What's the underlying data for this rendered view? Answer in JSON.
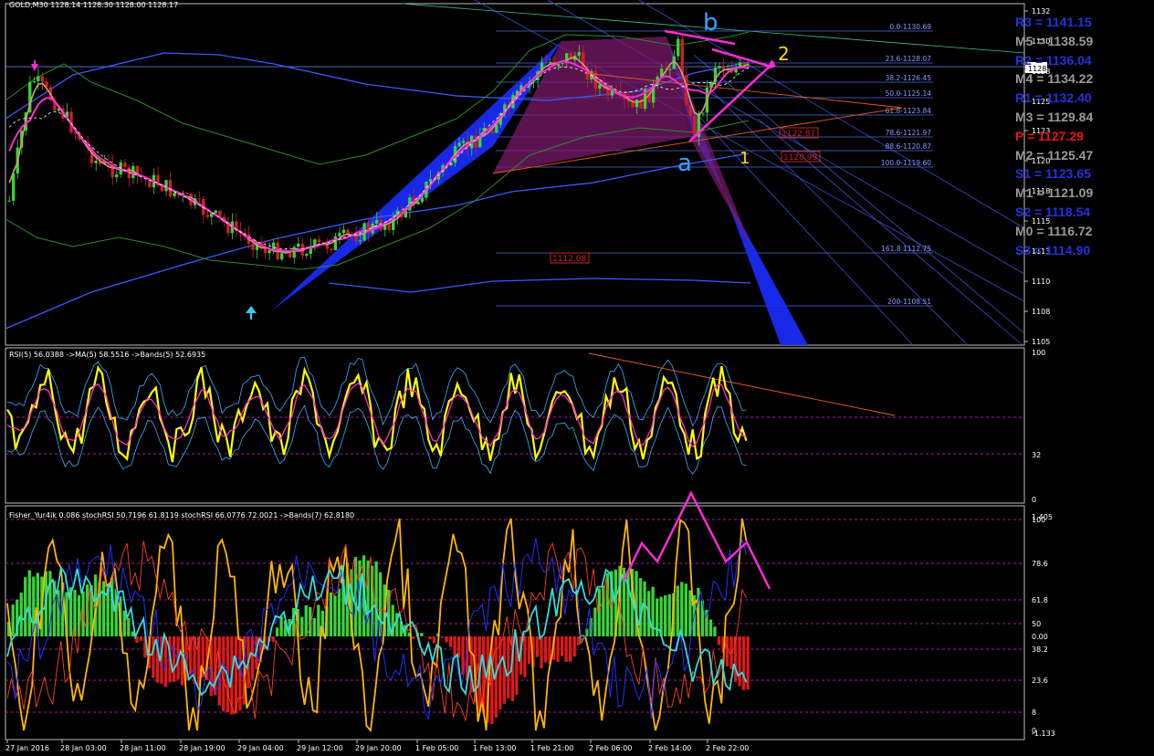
{
  "main": {
    "header": "GOLD,M30  1128.14 1128.30 1128.00 1128.17",
    "price_axis": [
      "1132",
      "1130",
      "1128",
      "1125",
      "1123",
      "1120",
      "1118",
      "1115",
      "1113",
      "1110",
      "1108",
      "1105"
    ],
    "current_price_tag": "1128",
    "fib_levels": [
      {
        "label": "0.0-1130.69",
        "color": "#4a6ae0"
      },
      {
        "label": "23.6-1128.07",
        "color": "#4a6ae0"
      },
      {
        "label": "38.2-1126.45",
        "color": "#4a6ae0"
      },
      {
        "label": "50.0-1125.14",
        "color": "#4a6ae0"
      },
      {
        "label": "61.8-1123.84",
        "color": "#4a6ae0"
      },
      {
        "label": "78.6-1121.97",
        "color": "#4a6ae0"
      },
      {
        "label": "88.6-1120.87",
        "color": "#4a6ae0"
      },
      {
        "label": "100.0-1119.60",
        "color": "#4a6ae0"
      },
      {
        "label": "161.8 1112.75",
        "color": "#4a6ae0"
      },
      {
        "label": "200-1108.51",
        "color": "#4a6ae0"
      }
    ],
    "boxed_prices": [
      "1122.87",
      "1120.99",
      "1112.08"
    ],
    "wave_labels": {
      "b": "b",
      "a": "a",
      "two": "2",
      "one": "1"
    },
    "pivots": [
      {
        "label": "R3 = 1141.15",
        "color": "#2233dd"
      },
      {
        "label": "M5 = 1138.59",
        "color": "#9a9a9a"
      },
      {
        "label": "R2 = 1136.04",
        "color": "#2233dd"
      },
      {
        "label": "M4 = 1134.22",
        "color": "#9a9a9a"
      },
      {
        "label": "R1 = 1132.40",
        "color": "#2233dd"
      },
      {
        "label": "M3 = 1129.84",
        "color": "#9a9a9a"
      },
      {
        "label": "P   = 1127.29",
        "color": "#ee1111"
      },
      {
        "label": "M2 = 1125.47",
        "color": "#9a9a9a"
      },
      {
        "label": "S1 = 1123.65",
        "color": "#2233dd"
      },
      {
        "label": "M1 = 1121.09",
        "color": "#9a9a9a"
      },
      {
        "label": "S2 = 1118.54",
        "color": "#2233dd"
      },
      {
        "label": "M0 = 1116.72",
        "color": "#9a9a9a"
      },
      {
        "label": "S3 = 1114.90",
        "color": "#2233dd"
      }
    ]
  },
  "rsi": {
    "header": "RSI(5) 56.0388  ->MA(5) 58.5516  ->Bands(5) 52.6935",
    "axis": [
      "100",
      "32",
      "0"
    ]
  },
  "fisher": {
    "header": "Fisher_Yur4ik 0.086  stochRSI 50.7196 61.8119  stochRSI 66.0776 72.0021  ->Bands(7) 62.8180",
    "axis": [
      "1.405",
      "100",
      "78.6",
      "61.8",
      "50",
      "0.00",
      "38.2",
      "23.6",
      "8",
      "0",
      "-1.133"
    ]
  },
  "time_axis": [
    "27 Jan 2016",
    "28 Jan 03:00",
    "28 Jan 11:00",
    "28 Jan 19:00",
    "29 Jan 04:00",
    "29 Jan 12:00",
    "29 Jan 20:00",
    "1 Feb 05:00",
    "1 Feb 13:00",
    "1 Feb 21:00",
    "2 Feb 06:00",
    "2 Feb 14:00",
    "2 Feb 22:00"
  ],
  "colors": {
    "up_candle": "#3bd23b",
    "down_candle": "#d22020",
    "ma_magenta": "#ff2bd6",
    "rsi_line": "#ffff00",
    "hist_up": "#3bd23b",
    "hist_down": "#e01818"
  }
}
